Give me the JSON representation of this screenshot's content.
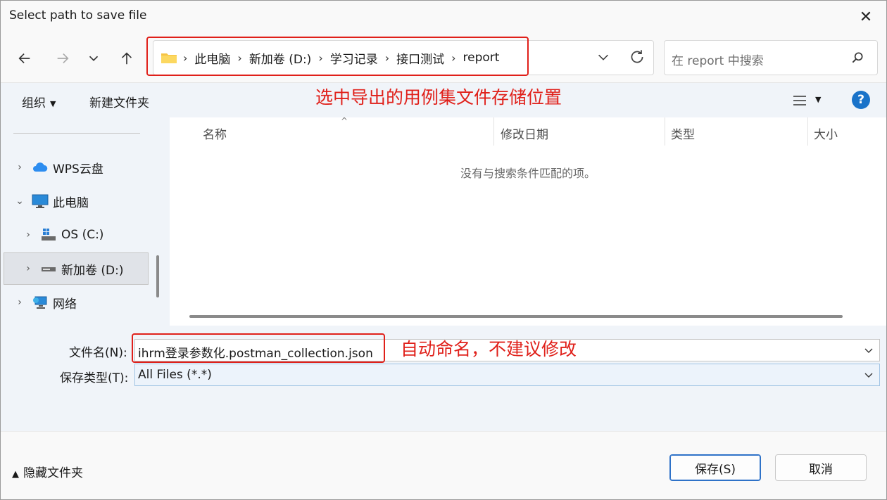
{
  "window": {
    "title": "Select path to save file",
    "close_label": "✕"
  },
  "address": {
    "segments": [
      "此电脑",
      "新加卷 (D:)",
      "学习记录",
      "接口测试",
      "report"
    ]
  },
  "search": {
    "placeholder": "在 report 中搜索"
  },
  "toolbar": {
    "organize": "组织",
    "new_folder": "新建文件夹"
  },
  "annotations": {
    "top": "选中导出的用例集文件存储位置",
    "filename": "自动命名，不建议修改"
  },
  "sidebar": {
    "items": [
      {
        "label": "WPS云盘",
        "icon": "cloud-icon",
        "expanded": false
      },
      {
        "label": "此电脑",
        "icon": "computer-icon",
        "expanded": true
      },
      {
        "label": "OS (C:)",
        "icon": "windows-drive-icon",
        "expanded": false
      },
      {
        "label": "新加卷 (D:)",
        "icon": "drive-icon",
        "expanded": false,
        "selected": true
      },
      {
        "label": "网络",
        "icon": "network-icon",
        "expanded": false
      }
    ]
  },
  "columns": [
    "名称",
    "修改日期",
    "类型",
    "大小"
  ],
  "empty_message": "没有与搜索条件匹配的项。",
  "form": {
    "filename_label": "文件名(N):",
    "filename_value": "ihrm登录参数化.postman_collection.json",
    "type_label": "保存类型(T):",
    "type_value": "All Files (*.*)"
  },
  "footer": {
    "hide_folders": "隐藏文件夹",
    "save": "保存(S)",
    "cancel": "取消"
  },
  "colors": {
    "accent": "#1a73c9",
    "annotation": "#e0201a",
    "selected_field": "#ecf3fb"
  }
}
